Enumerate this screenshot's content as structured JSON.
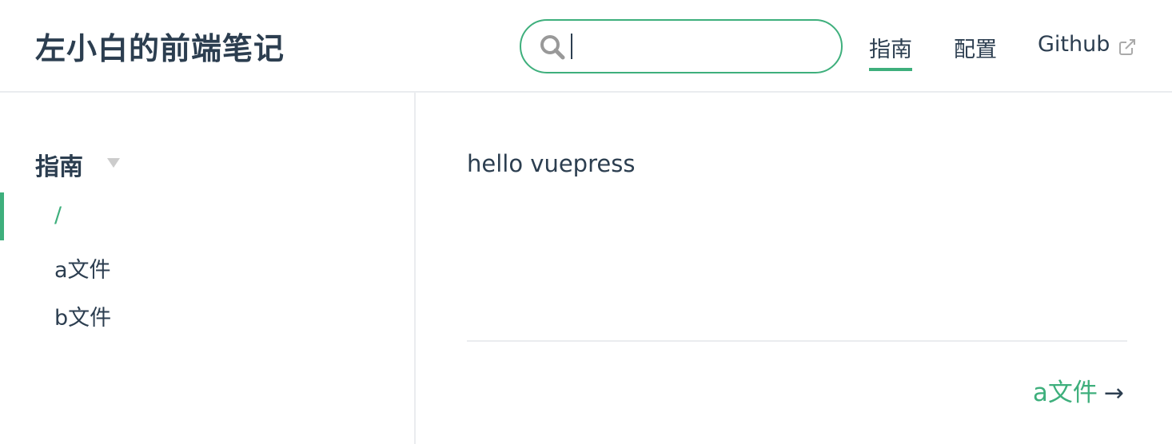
{
  "site": {
    "title": "左小白的前端笔记"
  },
  "search": {
    "value": "",
    "placeholder": ""
  },
  "nav": {
    "items": [
      {
        "label": "指南",
        "active": true
      },
      {
        "label": "配置",
        "active": false
      },
      {
        "label": "Github",
        "active": false,
        "external": true
      }
    ]
  },
  "sidebar": {
    "group_title": "指南",
    "items": [
      {
        "label": "/",
        "active": true
      },
      {
        "label": "a文件",
        "active": false
      },
      {
        "label": "b文件",
        "active": false
      }
    ]
  },
  "content": {
    "text": "hello vuepress",
    "next_label": "a文件",
    "next_arrow": "→"
  },
  "colors": {
    "accent": "#3eaf7c",
    "text": "#2c3e50",
    "border": "#eaecef"
  }
}
